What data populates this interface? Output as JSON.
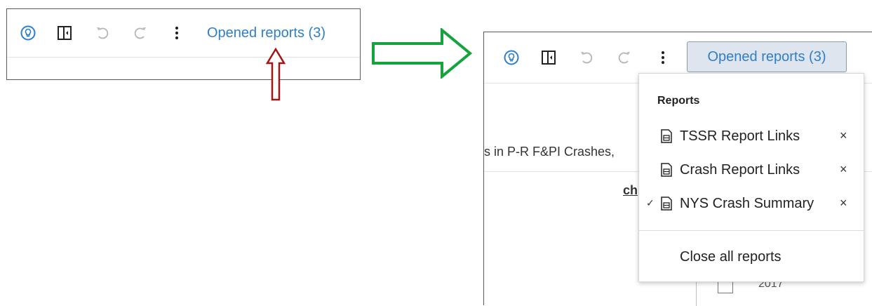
{
  "left_panel": {
    "opened_reports_label": "Opened reports (3)"
  },
  "right_panel": {
    "opened_reports_label": "Opened reports (3)",
    "background_text": "s in P-R F&PI Crashes,",
    "background_underlined": "ch",
    "background_year": "2017"
  },
  "dropdown": {
    "header": "Reports",
    "items": [
      {
        "label": "TSSR Report Links",
        "checked": false,
        "close": "×"
      },
      {
        "label": "Crash Report Links",
        "checked": false,
        "close": "×"
      },
      {
        "label": "NYS Crash Summary",
        "checked": true,
        "close": "×",
        "check_mark": "✓"
      }
    ],
    "close_all_label": "Close all reports"
  },
  "colors": {
    "link_blue": "#2e7fc7",
    "annotation_red": "#a31515",
    "annotation_green": "#14a33c"
  },
  "icons": [
    "lightbulb-icon",
    "panel-toggle-icon",
    "undo-icon",
    "redo-icon",
    "more-vertical-icon",
    "document-icon"
  ]
}
